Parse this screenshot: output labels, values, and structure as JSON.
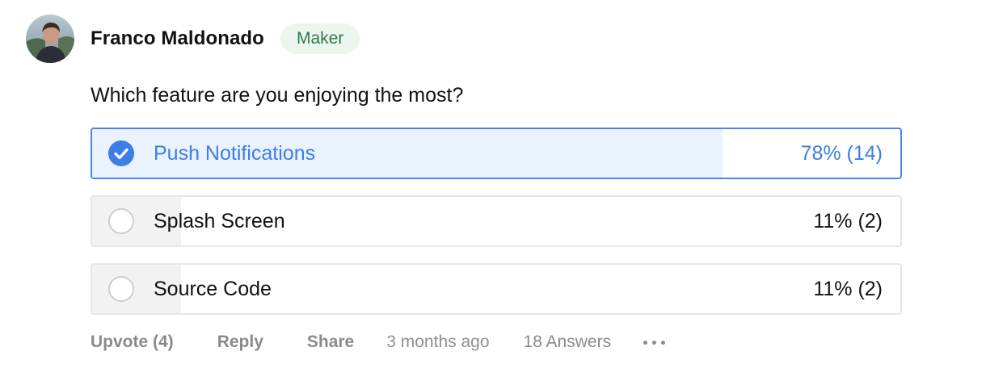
{
  "post": {
    "author": "Franco Maldonado",
    "badge": "Maker",
    "question": "Which feature are you enjoying the most?"
  },
  "poll": {
    "options": [
      {
        "label": "Push Notifications",
        "result": "78% (14)",
        "percent": 78,
        "selected": true
      },
      {
        "label": "Splash Screen",
        "result": "11% (2)",
        "percent": 11,
        "selected": false
      },
      {
        "label": "Source Code",
        "result": "11% (2)",
        "percent": 11,
        "selected": false
      }
    ]
  },
  "footer": {
    "upvote": "Upvote (4)",
    "reply": "Reply",
    "share": "Share",
    "timestamp": "3 months ago",
    "answers": "18 Answers"
  },
  "colors": {
    "accent": "#3d7ee6",
    "badge_bg": "#eaf6ee",
    "badge_text": "#2f7a4a"
  }
}
